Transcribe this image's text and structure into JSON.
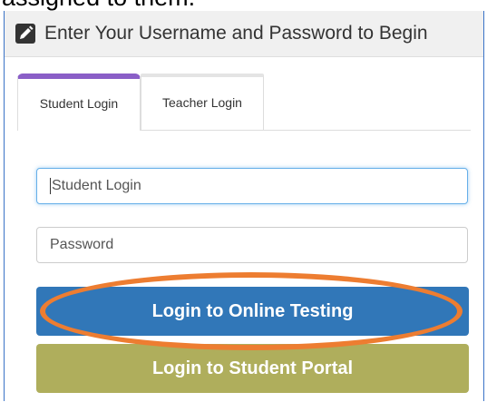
{
  "caption_fragment": "assigned to them.",
  "header": {
    "icon": "pencil-square-icon",
    "title": "Enter Your Username and Password to Begin"
  },
  "tabs": [
    {
      "label": "Student Login",
      "active": true
    },
    {
      "label": "Teacher Login",
      "active": false
    }
  ],
  "form": {
    "username_placeholder": "Student Login",
    "password_placeholder": "Password",
    "testing_button": "Login to Online Testing",
    "portal_button": "Login to Student Portal"
  },
  "colors": {
    "active_tab_accent": "#8a5fc7",
    "testing_button": "#3177b8",
    "portal_button": "#afae5c",
    "highlight_oval": "#ed7d31"
  }
}
